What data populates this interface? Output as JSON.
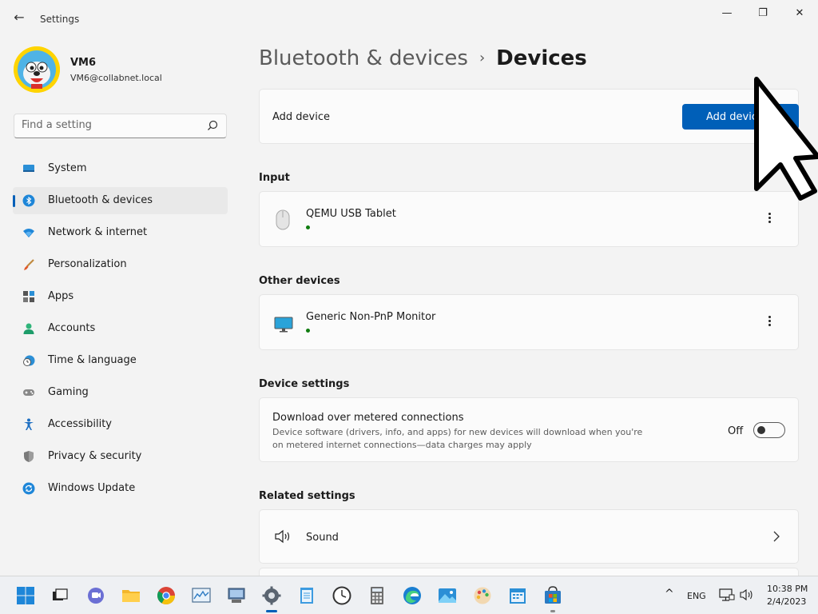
{
  "window": {
    "title": "Settings",
    "back_icon": "←",
    "minimize_icon": "—",
    "maximize_icon": "❐",
    "close_icon": "✕"
  },
  "profile": {
    "name": "VM6",
    "email": "VM6@collabnet.local"
  },
  "search": {
    "placeholder": "Find a setting"
  },
  "sidebar": {
    "items": [
      {
        "label": "System",
        "icon": "system-icon"
      },
      {
        "label": "Bluetooth & devices",
        "icon": "bluetooth-icon",
        "selected": true
      },
      {
        "label": "Network & internet",
        "icon": "wifi-icon"
      },
      {
        "label": "Personalization",
        "icon": "brush-icon"
      },
      {
        "label": "Apps",
        "icon": "apps-icon"
      },
      {
        "label": "Accounts",
        "icon": "person-icon"
      },
      {
        "label": "Time & language",
        "icon": "clock-globe-icon"
      },
      {
        "label": "Gaming",
        "icon": "gamepad-icon"
      },
      {
        "label": "Accessibility",
        "icon": "accessibility-icon"
      },
      {
        "label": "Privacy & security",
        "icon": "shield-icon"
      },
      {
        "label": "Windows Update",
        "icon": "update-icon"
      }
    ]
  },
  "breadcrumb": {
    "parent": "Bluetooth & devices",
    "separator": "›",
    "current": "Devices"
  },
  "add_device_card": {
    "title": "Add device",
    "button_label": "Add device"
  },
  "input_section": {
    "header": "Input",
    "device_name": "QEMU USB Tablet"
  },
  "other_section": {
    "header": "Other devices",
    "device_name": "Generic Non-PnP Monitor"
  },
  "device_settings": {
    "header": "Device settings",
    "title": "Download over metered connections",
    "description": "Device software (drivers, info, and apps) for new devices will download when you're on metered internet connections—data charges may apply",
    "toggle_label": "Off",
    "toggle_on": false
  },
  "related_settings": {
    "header": "Related settings",
    "sound_label": "Sound"
  },
  "taskbar": {
    "language": "ENG",
    "time": "10:38 PM",
    "date": "2/4/2023",
    "chevron_up": "^"
  },
  "colors": {
    "accent": "#005fb8",
    "status_connected": "#107c10"
  }
}
